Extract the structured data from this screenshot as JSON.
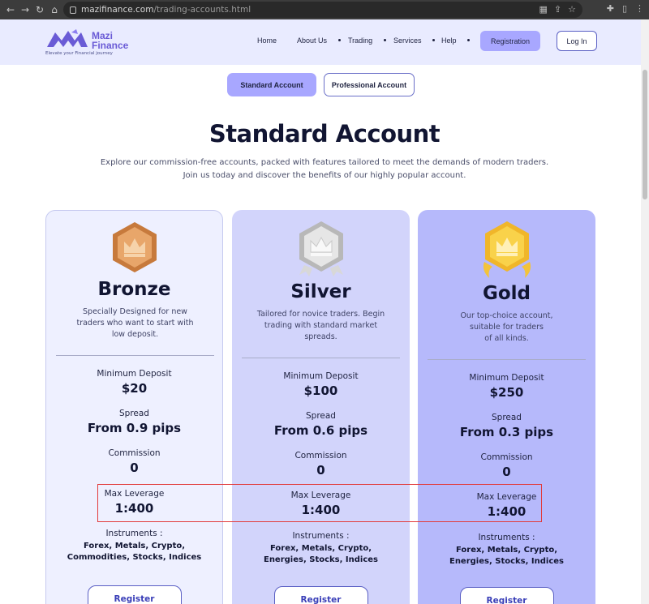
{
  "browser": {
    "url_host": "mazifinance.com",
    "url_path": "/trading-accounts.html"
  },
  "site": {
    "logo_name_line1": "Mazi",
    "logo_name_line2": "Finance",
    "tagline": "Elevate your Financial journey",
    "nav": {
      "home": "Home",
      "about": "About Us",
      "trading": "Trading",
      "services": "Services",
      "help": "Help",
      "registration": "Registration",
      "login": "Log In"
    },
    "brand_color": "#6a5bd6"
  },
  "tabs": {
    "standard": "Standard Account",
    "professional": "Professional Account"
  },
  "heading": {
    "title": "Standard Account",
    "intro_line1": "Explore our commission-free accounts, packed with features tailored to meet the demands of modern traders.",
    "intro_line2": "Join us today and discover the benefits of our highly popular account."
  },
  "labels": {
    "min_deposit": "Minimum Deposit",
    "spread": "Spread",
    "commission": "Commission",
    "max_leverage": "Max Leverage",
    "instruments": "Instruments :",
    "register": "Register"
  },
  "cards": {
    "bronze": {
      "name": "Bronze",
      "desc_line1": "Specially Designed for new",
      "desc_line2": "traders who want to start with",
      "desc_line3": "low deposit.",
      "min_deposit": "$20",
      "spread": "From 0.9 pips",
      "commission": "0",
      "max_leverage": "1:400",
      "instruments_line1": "Forex, Metals, Crypto,",
      "instruments_line2": "Commodities, Stocks, Indices",
      "badge_icon": "crown-icon",
      "color": "#e5a464"
    },
    "silver": {
      "name": "Silver",
      "desc_line1": "Tailored for novice traders. Begin",
      "desc_line2": "trading with standard market",
      "desc_line3": "spreads.",
      "min_deposit": "$100",
      "spread": "From 0.6 pips",
      "commission": "0",
      "max_leverage": "1:400",
      "instruments_line1": "Forex, Metals, Crypto,",
      "instruments_line2": "Energies, Stocks, Indices",
      "badge_icon": "crown-icon",
      "color": "#d9d9d9"
    },
    "gold": {
      "name": "Gold",
      "desc_line1": "Our top-choice account,",
      "desc_line2": "suitable for traders",
      "desc_line3": "of all kinds.",
      "min_deposit": "$250",
      "spread": "From 0.3 pips",
      "commission": "0",
      "max_leverage": "1:400",
      "instruments_line1": "Forex, Metals, Crypto,",
      "instruments_line2": "Energies, Stocks, Indices",
      "badge_icon": "crown-icon",
      "color": "#f7c93a"
    }
  }
}
